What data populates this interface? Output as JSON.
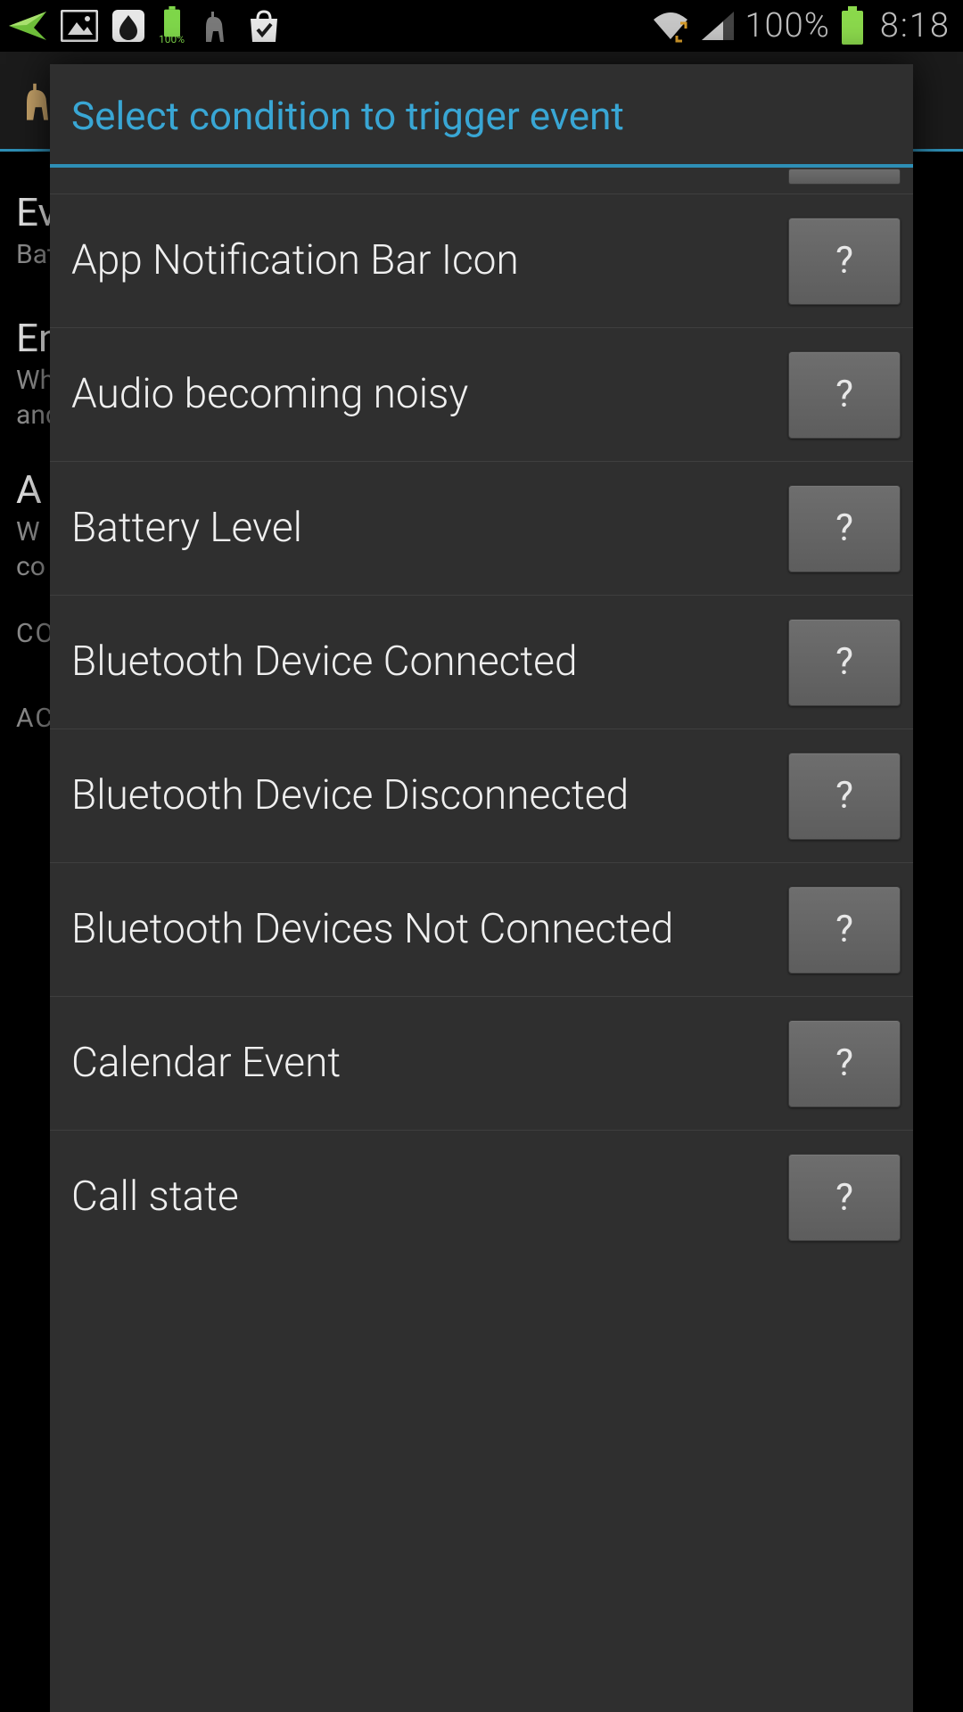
{
  "status": {
    "battery_small_label": "100%",
    "battery_pct": "100%",
    "clock": "8:18"
  },
  "background": {
    "row1_title": "Ev",
    "row1_sub": "Bat",
    "row2_title": "En",
    "row2_sub_a": "Wh",
    "row2_sub_b": "and",
    "row3_title": "A",
    "row3_sub_a": "W",
    "row3_sub_b": "co",
    "section1": "CO",
    "section2": "AC"
  },
  "dialog": {
    "title": "Select condition to trigger event",
    "help_label": "?",
    "items": [
      {
        "label": "App Notification Bar Icon"
      },
      {
        "label": "Audio becoming noisy"
      },
      {
        "label": "Battery Level"
      },
      {
        "label": "Bluetooth Device Connected"
      },
      {
        "label": "Bluetooth Device Disconnected"
      },
      {
        "label": "Bluetooth Devices Not Connected"
      },
      {
        "label": "Calendar Event"
      },
      {
        "label": "Call state"
      }
    ]
  }
}
